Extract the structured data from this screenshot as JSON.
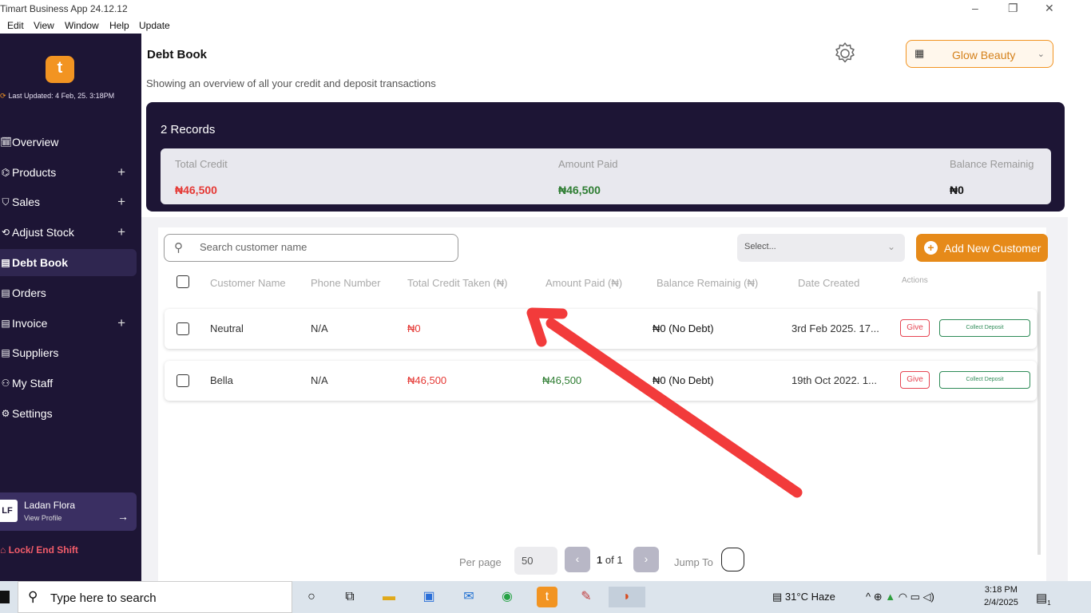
{
  "window": {
    "title": "Timart Business App 24.12.12",
    "minimize": "–",
    "restore": "❐",
    "close": "✕"
  },
  "menu": [
    "Edit",
    "View",
    "Window",
    "Help",
    "Update"
  ],
  "sidebar": {
    "logo_letter": "t",
    "last_updated": "Last Updated: 4 Feb, 25. 3:18PM",
    "items": [
      {
        "label": "Overview",
        "icon": "calendar-check-icon",
        "glyph": "🗓",
        "expandable": false
      },
      {
        "label": "Products",
        "icon": "box-icon",
        "glyph": "⌬",
        "expandable": true
      },
      {
        "label": "Sales",
        "icon": "cart-icon",
        "glyph": "⛉",
        "expandable": true
      },
      {
        "label": "Adjust Stock",
        "icon": "adjust-icon",
        "glyph": "⟲",
        "expandable": true
      },
      {
        "label": "Debt Book",
        "icon": "book-icon",
        "glyph": "▤",
        "expandable": false,
        "active": true
      },
      {
        "label": "Orders",
        "icon": "orders-icon",
        "glyph": "▤",
        "expandable": false
      },
      {
        "label": "Invoice",
        "icon": "invoice-icon",
        "glyph": "▤",
        "expandable": true
      },
      {
        "label": "Suppliers",
        "icon": "suppliers-icon",
        "glyph": "▤",
        "expandable": false
      },
      {
        "label": "My Staff",
        "icon": "staff-icon",
        "glyph": "⚇",
        "expandable": false
      },
      {
        "label": "Settings",
        "icon": "gear-icon",
        "glyph": "⚙",
        "expandable": false
      }
    ],
    "expand_symbol": "+",
    "profile": {
      "initials": "LF",
      "name": "Ladan Flora",
      "view": "View Profile",
      "arrow": "→"
    },
    "lock": "Lock/ End Shift"
  },
  "header": {
    "title": "Debt Book",
    "subtitle": "Showing an overview of all your credit and deposit transactions",
    "store_name": "Glow Beauty"
  },
  "summary": {
    "records": "2 Records",
    "total_credit_label": "Total Credit",
    "total_credit_value": "₦46,500",
    "amount_paid_label": "Amount Paid",
    "amount_paid_value": "₦46,500",
    "balance_label": "Balance Remainig",
    "balance_value": "₦0"
  },
  "colors": {
    "credit": "#e53935",
    "paid": "#2e7d32",
    "accent": "#e68a19",
    "sidebar": "#1d1535"
  },
  "toolbar": {
    "search_placeholder": "Search customer name",
    "select_placeholder": "Select...",
    "add_button": "Add New Customer"
  },
  "table": {
    "columns": [
      "Customer Name",
      "Phone Number",
      "Total Credit Taken (₦)",
      "Amount Paid (₦)",
      "Balance Remainig (₦)",
      "Date Created",
      "Actions"
    ],
    "rows": [
      {
        "name": "Neutral",
        "phone": "N/A",
        "credit": "₦0",
        "paid": "",
        "balance": "₦0 (No Debt)",
        "date": "3rd Feb 2025. 17...",
        "give": "Give",
        "collect": "Collect Deposit"
      },
      {
        "name": "Bella",
        "phone": "N/A",
        "credit": "₦46,500",
        "paid": "₦46,500",
        "balance": "₦0 (No Debt)",
        "date": "19th Oct 2022. 1...",
        "give": "Give",
        "collect": "Collect Deposit"
      }
    ]
  },
  "pagination": {
    "per_page_label": "Per page",
    "per_page_value": "50",
    "current": "1",
    "of_text": "of 1",
    "prev": "‹",
    "next": "›",
    "jump_label": "Jump To"
  },
  "taskbar": {
    "search_text": "Type here to search",
    "weather": "31°C  Haze",
    "time": "3:18 PM",
    "date": "2/4/2025",
    "notification_count": "1"
  }
}
